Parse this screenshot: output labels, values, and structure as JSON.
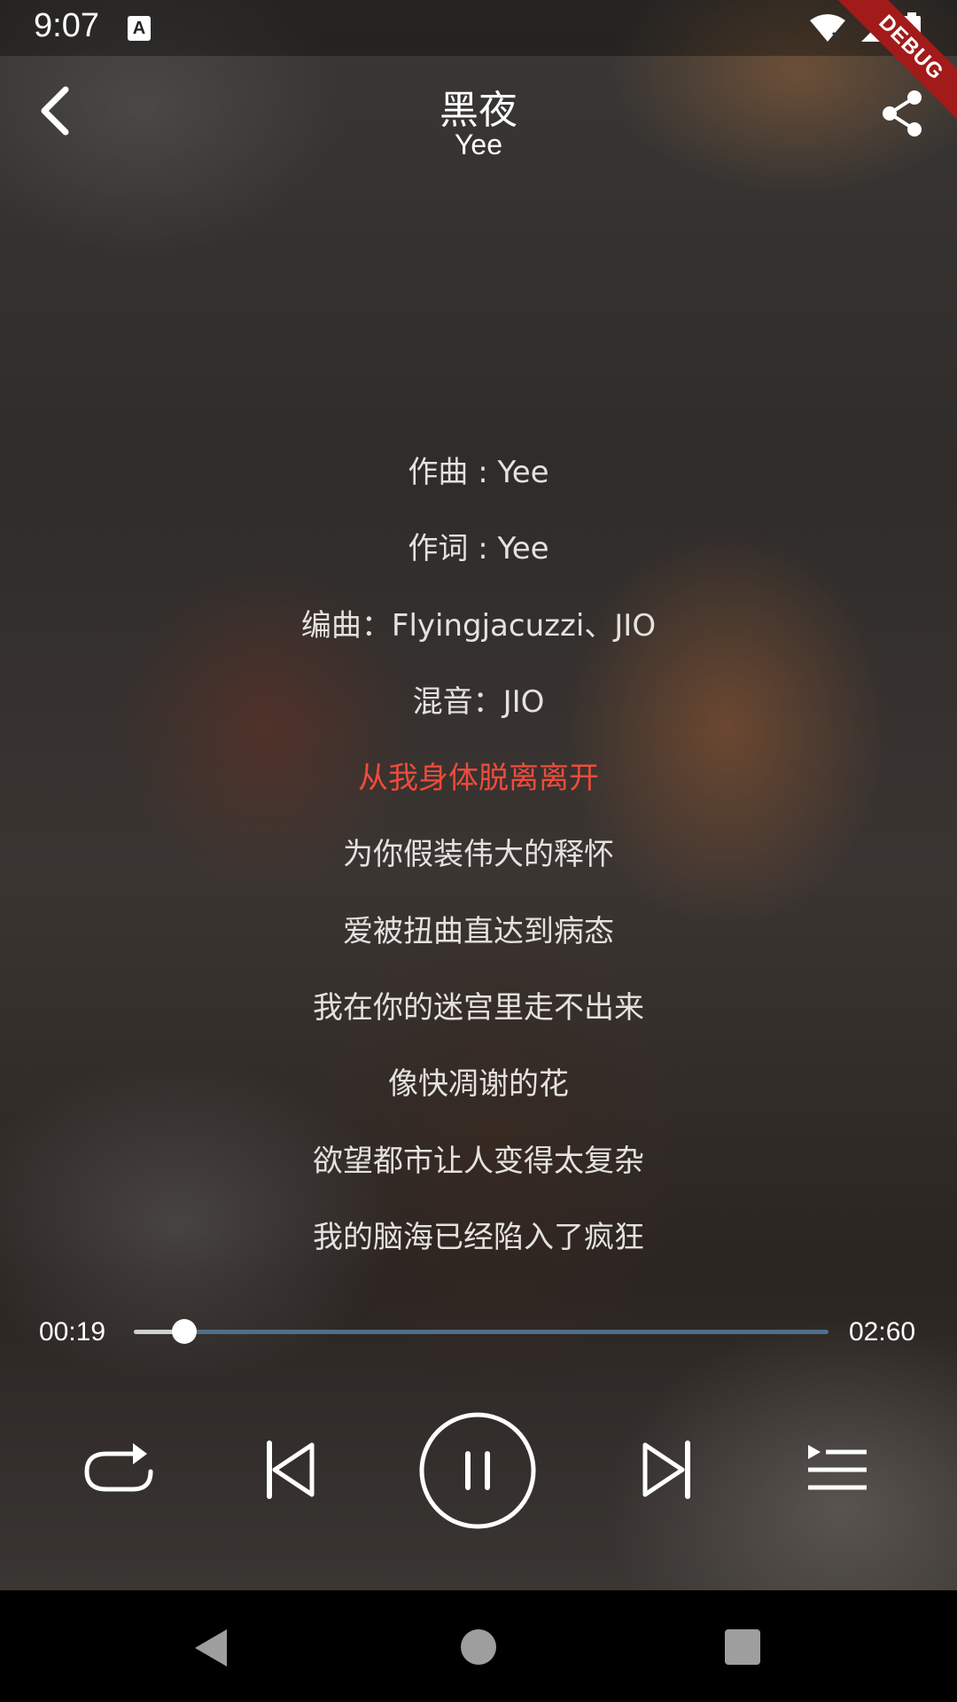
{
  "status_bar": {
    "time": "9:07",
    "keyboard_badge": "A",
    "icons": [
      "wifi-x-icon",
      "cellular-signal-icon",
      "battery-icon"
    ]
  },
  "debug_banner": "DEBUG",
  "header": {
    "title": "黑夜",
    "artist": "Yee",
    "back_icon": "chevron-left-icon",
    "share_icon": "share-icon"
  },
  "lyrics": {
    "active_index": 4,
    "active_color": "#ee4b3b",
    "lines": [
      "作曲 : Yee",
      "作词 : Yee",
      "编曲：Flyingjacuzzi、JIO",
      "混音：JIO",
      "从我身体脱离离开",
      "为你假装伟大的释怀",
      "爱被扭曲直达到病态",
      "我在你的迷宫里走不出来",
      "像快凋谢的花",
      "欲望都市让人变得太复杂",
      "我的脑海已经陷入了疯狂"
    ]
  },
  "player": {
    "current_time": "00:19",
    "total_time": "02:60",
    "progress": 0.073,
    "track_color": "#4e6f8a",
    "controls": {
      "repeat": "repeat-icon",
      "previous": "skip-previous-icon",
      "play_pause": "pause-icon",
      "next": "skip-next-icon",
      "playlist": "playlist-icon"
    }
  },
  "nav_bar": {
    "back": "nav-back-icon",
    "home": "nav-home-icon",
    "recents": "nav-recents-icon"
  }
}
